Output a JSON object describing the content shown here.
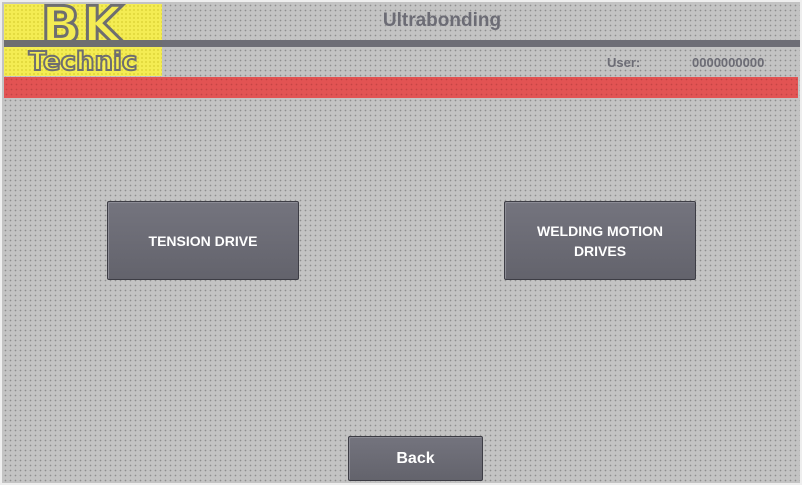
{
  "header": {
    "logo": {
      "line1": "BK",
      "line2": "Technic",
      "colors": {
        "background": "#f4ec53",
        "ink": "#6e6e70"
      }
    },
    "title": "Ultrabonding",
    "user_label": "User:",
    "user_value": "0000000000"
  },
  "alarm_bar": {
    "color": "#e25353"
  },
  "buttons": {
    "tension_drive": "TENSION DRIVE",
    "welding_motion_drives": "WELDING MOTION DRIVES",
    "back": "Back"
  },
  "colors": {
    "background": "#c3c3c3",
    "button": "#6a6a73",
    "header_text": "#6c6c75"
  }
}
